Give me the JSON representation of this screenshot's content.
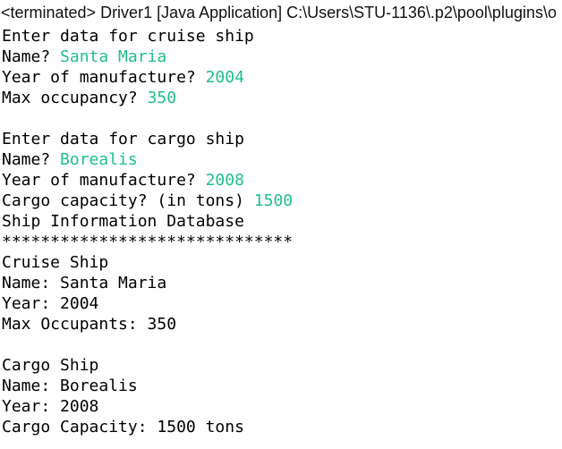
{
  "header": {
    "title": "<terminated> Driver1 [Java Application] C:\\Users\\STU-1136\\.p2\\pool\\plugins\\o"
  },
  "console": {
    "input_color": "#1fbf8a",
    "lines": [
      {
        "prompt": "Enter data for cruise ship",
        "input": ""
      },
      {
        "prompt": "Name? ",
        "input": "Santa Maria"
      },
      {
        "prompt": "Year of manufacture? ",
        "input": "2004"
      },
      {
        "prompt": "Max occupancy? ",
        "input": "350"
      },
      {
        "prompt": "",
        "input": ""
      },
      {
        "prompt": "Enter data for cargo ship",
        "input": ""
      },
      {
        "prompt": "Name? ",
        "input": "Borealis"
      },
      {
        "prompt": "Year of manufacture? ",
        "input": "2008"
      },
      {
        "prompt": "Cargo capacity? (in tons) ",
        "input": "1500"
      },
      {
        "prompt": "Ship Information Database",
        "input": ""
      },
      {
        "prompt": "******************************",
        "input": ""
      },
      {
        "prompt": "Cruise Ship",
        "input": ""
      },
      {
        "prompt": "Name: Santa Maria",
        "input": ""
      },
      {
        "prompt": "Year: 2004",
        "input": ""
      },
      {
        "prompt": "Max Occupants: 350",
        "input": ""
      },
      {
        "prompt": "",
        "input": ""
      },
      {
        "prompt": "Cargo Ship",
        "input": ""
      },
      {
        "prompt": "Name: Borealis",
        "input": ""
      },
      {
        "prompt": "Year: 2008",
        "input": ""
      },
      {
        "prompt": "Cargo Capacity: 1500 tons",
        "input": ""
      }
    ]
  }
}
